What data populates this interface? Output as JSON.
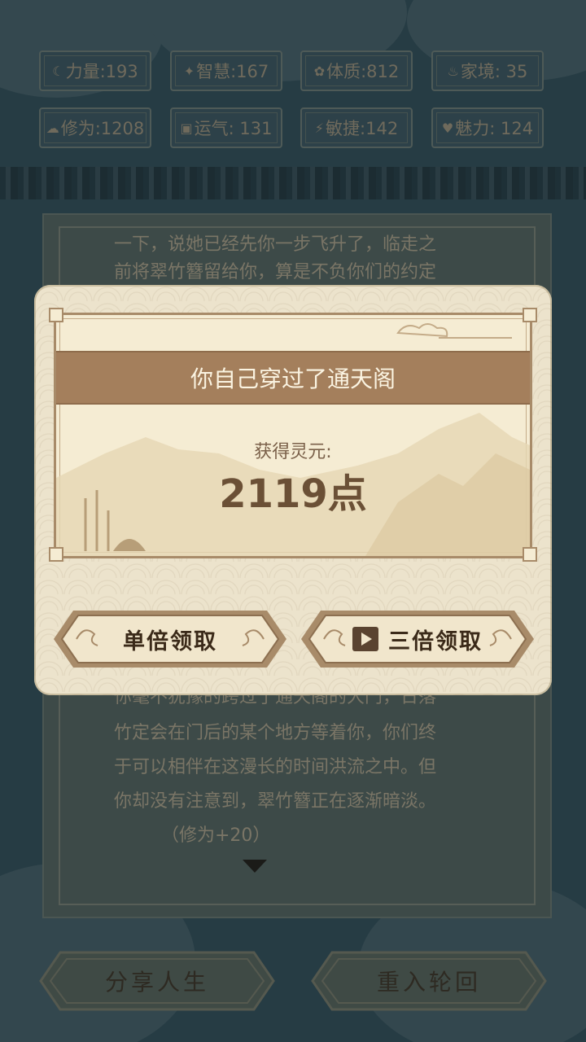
{
  "stats": [
    {
      "label": "力量:193",
      "icon": "muscle-icon",
      "glyph": "☾"
    },
    {
      "label": "智慧:167",
      "icon": "lightbulb-icon",
      "glyph": "✦"
    },
    {
      "label": "体质:812",
      "icon": "flower-icon",
      "glyph": "✿"
    },
    {
      "label": "家境: 35",
      "icon": "family-icon",
      "glyph": "♨"
    },
    {
      "label": "修为:1208",
      "icon": "cloud-icon",
      "glyph": "☁"
    },
    {
      "label": "运气: 131",
      "icon": "luck-icon",
      "glyph": "▣"
    },
    {
      "label": "敏捷:142",
      "icon": "lightning-icon",
      "glyph": "⚡"
    },
    {
      "label": "魅力: 124",
      "icon": "heart-icon",
      "glyph": "♥"
    }
  ],
  "story": {
    "line_top1": "一下，说她已经先你一步飞升了，临走之",
    "line_top2": "前将翠竹簪留给你，算是不负你们的约定",
    "lines": [
      "你毫不犹豫的跨过了通天阁的大门，日落",
      "竹定会在门后的某个地方等着你，你们终",
      "于可以相伴在这漫长的时间洪流之中。但",
      "你却没有注意到，翠竹簪正在逐渐暗淡。",
      "（修为+20）"
    ]
  },
  "modal": {
    "title": "你自己穿过了通天阁",
    "reward_label": "获得灵元:",
    "reward_amount": "2119点",
    "single_claim": "单倍领取",
    "triple_claim": "三倍领取"
  },
  "bottom": {
    "share": "分享人生",
    "reincarnate": "重入轮回"
  },
  "colors": {
    "background": "#263c44",
    "modal_bg": "#ece3cc",
    "header_brown": "#a47f5c",
    "button_gold": "#e8d6b2"
  }
}
